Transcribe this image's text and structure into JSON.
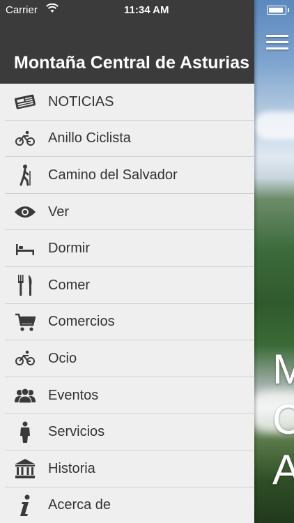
{
  "status_bar": {
    "carrier": "Carrier",
    "time": "11:34 AM"
  },
  "header": {
    "title": "Montaña Central de Asturias"
  },
  "menu": {
    "items": [
      {
        "label": "NOTICIAS",
        "icon": "newspaper-icon"
      },
      {
        "label": "Anillo Ciclista",
        "icon": "bicycle-icon"
      },
      {
        "label": "Camino del Salvador",
        "icon": "hiker-icon"
      },
      {
        "label": "Ver",
        "icon": "eye-icon"
      },
      {
        "label": "Dormir",
        "icon": "bed-icon"
      },
      {
        "label": "Comer",
        "icon": "fork-knife-icon"
      },
      {
        "label": "Comercios",
        "icon": "shopping-cart-icon"
      },
      {
        "label": "Ocio",
        "icon": "bicycle-icon"
      },
      {
        "label": "Eventos",
        "icon": "people-icon"
      },
      {
        "label": "Servicios",
        "icon": "person-icon"
      },
      {
        "label": "Historia",
        "icon": "museum-icon"
      },
      {
        "label": "Acerca de",
        "icon": "info-icon"
      }
    ]
  },
  "background_view": {
    "letters": [
      "M",
      "C",
      "A"
    ]
  },
  "colors": {
    "header_bg": "#3b3b3b",
    "menu_bg": "#efefef",
    "text": "#333333",
    "icon": "#3a3a3a"
  }
}
